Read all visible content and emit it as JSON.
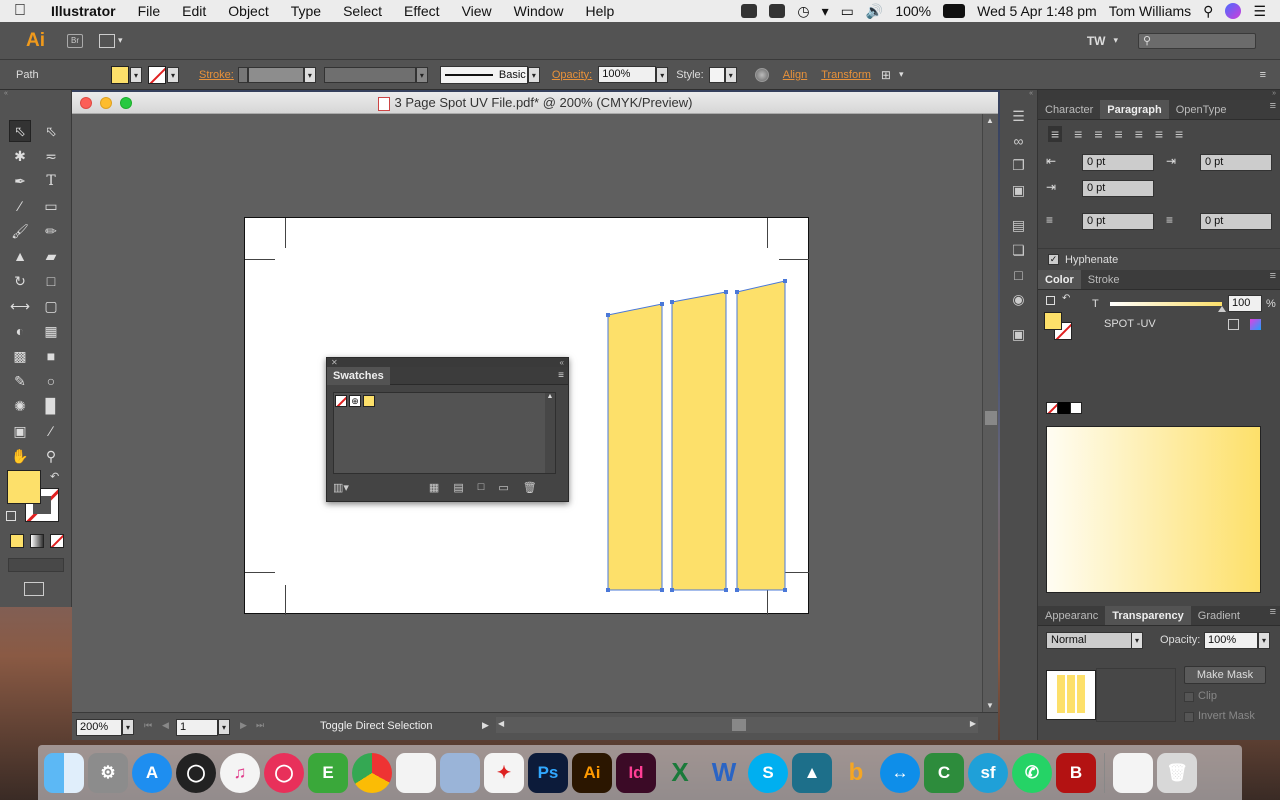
{
  "menubar": {
    "app": "Illustrator",
    "items": [
      "File",
      "Edit",
      "Object",
      "Type",
      "Select",
      "Effect",
      "View",
      "Window",
      "Help"
    ],
    "battery": "100%",
    "datetime": "Wed 5 Apr  1:48 pm",
    "user": "Tom Williams"
  },
  "appbar": {
    "logo": "Ai",
    "bridge": "Br",
    "workspace_user": "TW"
  },
  "control": {
    "selection": "Path",
    "stroke_label": "Stroke:",
    "brush": "Basic",
    "opacity_label": "Opacity:",
    "opacity": "100%",
    "style_label": "Style:",
    "align": "Align",
    "transform": "Transform"
  },
  "document": {
    "title": "3 Page Spot UV File.pdf* @ 200% (CMYK/Preview)"
  },
  "swatches": {
    "title": "Swatches"
  },
  "status": {
    "zoom": "200%",
    "page": "1",
    "tool": "Toggle Direct Selection"
  },
  "character": {
    "tabs": [
      "Character",
      "Paragraph",
      "OpenType"
    ],
    "fields": [
      "0 pt",
      "0 pt",
      "0 pt",
      "0 pt",
      "0 pt"
    ],
    "hyphenate": "Hyphenate"
  },
  "color": {
    "tabs": [
      "Color",
      "Stroke"
    ],
    "tint_label": "T",
    "tint": "100",
    "pct": "%",
    "swatch_name": "SPOT -UV",
    "fill": "#fde06a"
  },
  "transparency": {
    "tabs": [
      "Appearanc",
      "Transparency",
      "Gradient"
    ],
    "blend": "Normal",
    "opacity_label": "Opacity:",
    "opacity": "100%",
    "make_mask": "Make Mask",
    "clip": "Clip",
    "invert": "Invert Mask"
  },
  "dock": {
    "apps": [
      "finder",
      "system-prefs",
      "app-store",
      "dashboard",
      "itunes",
      "clip",
      "evernote",
      "chrome",
      "textedit",
      "preview",
      "acrobat",
      "Ps",
      "Ai",
      "Id",
      "excel-x",
      "word-w",
      "skype",
      "vpn",
      "hangouts",
      "teamviewer",
      "numbers",
      "sf",
      "whatsapp",
      "b-app"
    ]
  }
}
